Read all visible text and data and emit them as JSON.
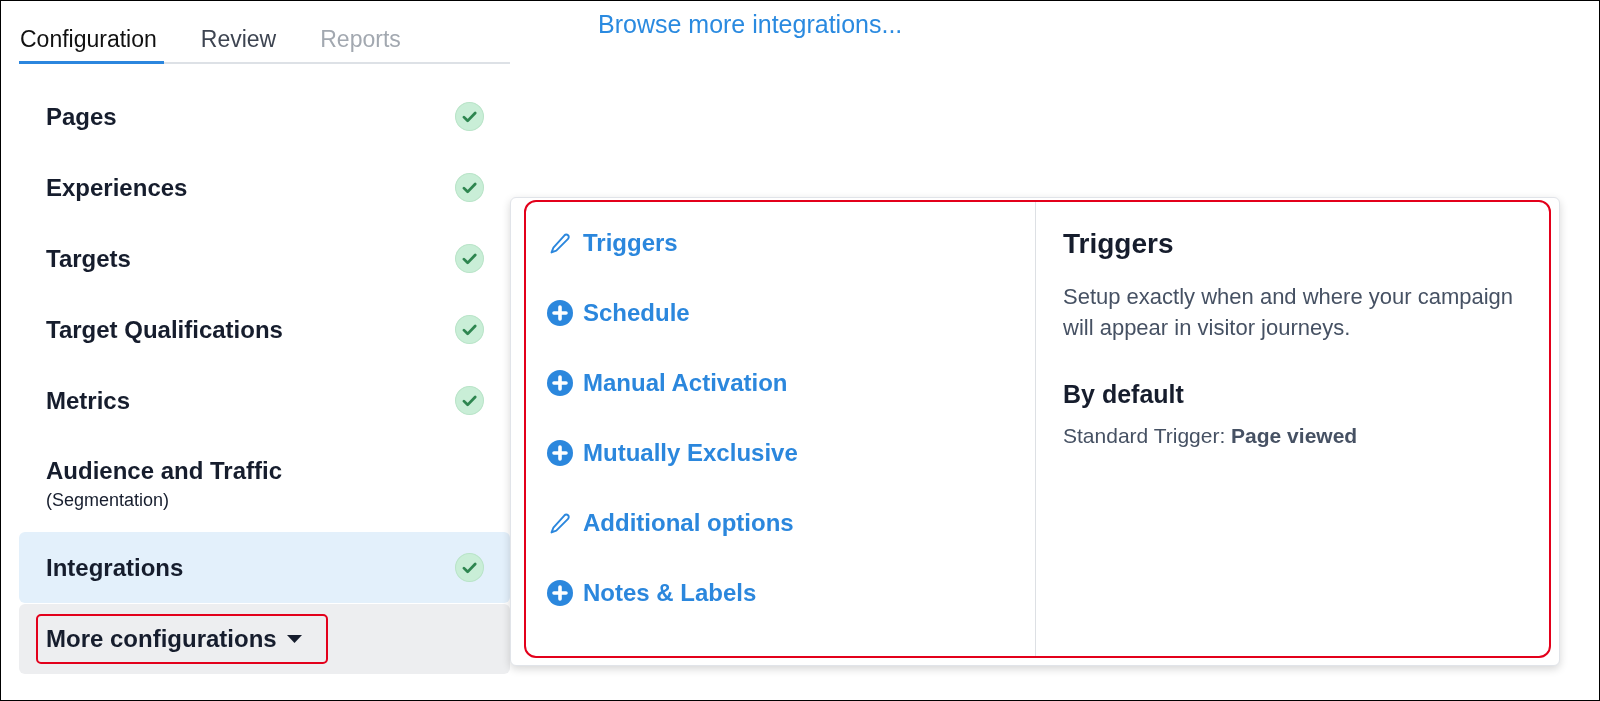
{
  "tabs": [
    {
      "label": "Configuration",
      "selected": true,
      "disabled": false
    },
    {
      "label": "Review",
      "selected": false,
      "disabled": false
    },
    {
      "label": "Reports",
      "selected": false,
      "disabled": true
    }
  ],
  "sidebar": {
    "items": [
      {
        "label": "Pages",
        "complete": true,
        "selected": false
      },
      {
        "label": "Experiences",
        "complete": true,
        "selected": false
      },
      {
        "label": "Targets",
        "complete": true,
        "selected": false
      },
      {
        "label": "Target Qualifications",
        "complete": true,
        "selected": false
      },
      {
        "label": "Metrics",
        "complete": true,
        "selected": false
      },
      {
        "label": "Audience and Traffic",
        "sublabel": "(Segmentation)",
        "complete": false,
        "selected": false
      },
      {
        "label": "Integrations",
        "complete": true,
        "selected": true
      }
    ],
    "more_button": {
      "label": "More configurations",
      "highlighted": true
    }
  },
  "browse_link": {
    "label": "Browse more integrations..."
  },
  "popover": {
    "highlighted": true,
    "menu": [
      {
        "label": "Triggers",
        "kind": "edit"
      },
      {
        "label": "Schedule",
        "kind": "add"
      },
      {
        "label": "Manual Activation",
        "kind": "add"
      },
      {
        "label": "Mutually Exclusive",
        "kind": "add"
      },
      {
        "label": "Additional options",
        "kind": "edit"
      },
      {
        "label": "Notes & Labels",
        "kind": "add"
      }
    ],
    "detail": {
      "title": "Triggers",
      "description": "Setup exactly when and where your campaign will appear in visitor journeys.",
      "subtitle": "By default",
      "note": "Standard Trigger: **Page viewed**"
    }
  }
}
